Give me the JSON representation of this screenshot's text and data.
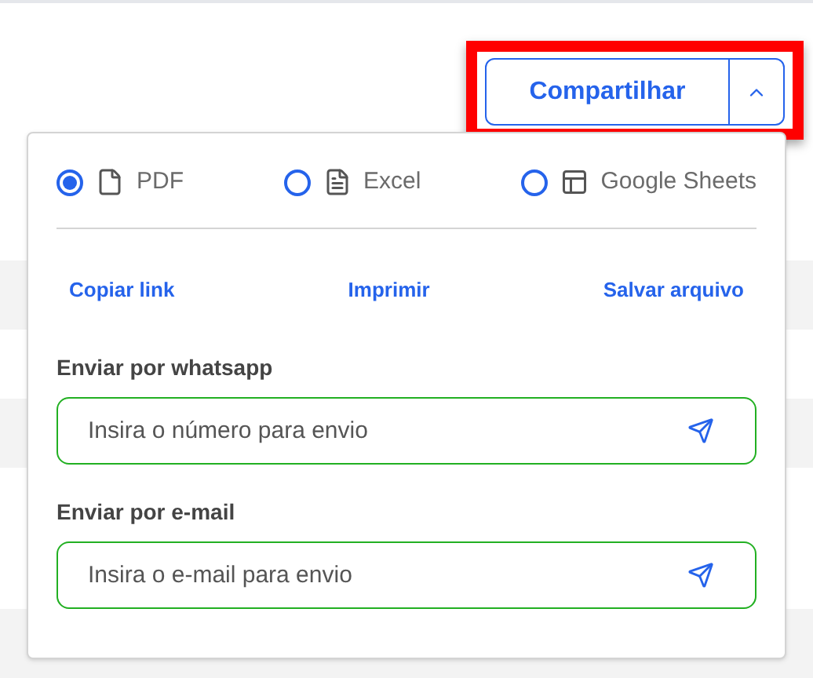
{
  "share_button": {
    "label": "Compartilhar",
    "expanded": true,
    "highlighted": true
  },
  "formats": [
    {
      "label": "PDF",
      "selected": true,
      "kind": "file"
    },
    {
      "label": "Excel",
      "selected": false,
      "kind": "document"
    },
    {
      "label": "Google Sheets",
      "selected": false,
      "kind": "layout"
    }
  ],
  "actions": [
    "Copiar link",
    "Imprimir",
    "Salvar arquivo"
  ],
  "send_fields": [
    {
      "label": "Enviar por whatsapp",
      "placeholder": "Insira o número para envio"
    },
    {
      "label": "Enviar por e-mail",
      "placeholder": "Insira o e-mail para envio"
    }
  ]
}
